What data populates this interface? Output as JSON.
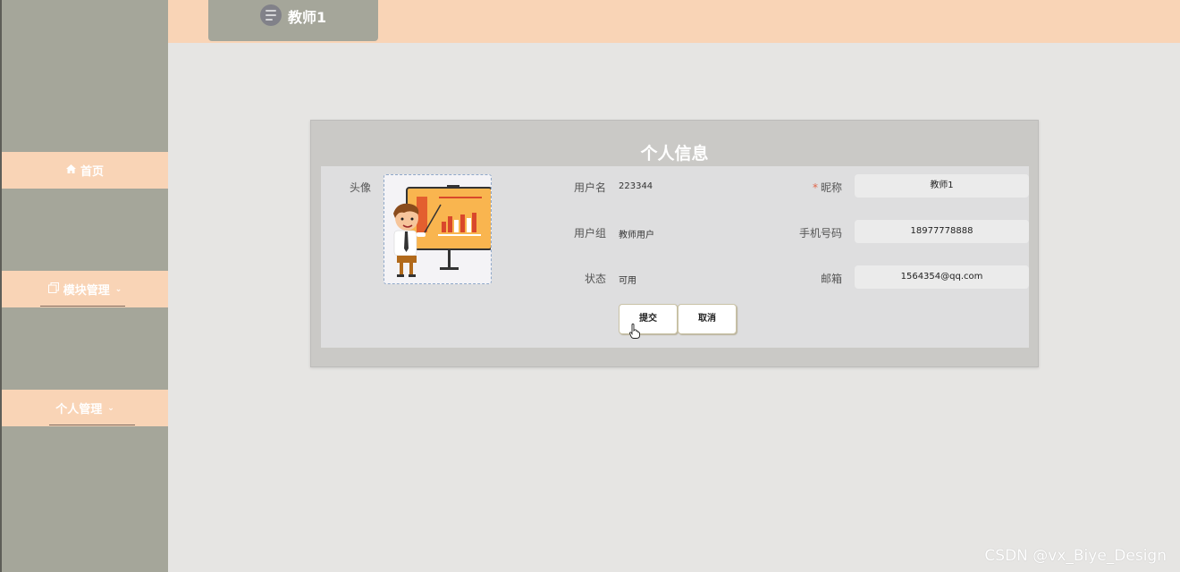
{
  "header": {
    "user_name": "教师1"
  },
  "sidebar": {
    "items": [
      {
        "label": "首页",
        "icon": "home-icon"
      },
      {
        "label": "模块管理",
        "icon": "copy-icon",
        "chevron": "⌄"
      },
      {
        "label": "个人管理",
        "chevron": "⌄"
      }
    ]
  },
  "form": {
    "title": "个人信息",
    "avatar_label": "头像",
    "username_label": "用户名",
    "username_value": "223344",
    "group_label": "用户组",
    "group_value": "教师用户",
    "status_label": "状态",
    "status_value": "可用",
    "nickname_label": "昵称",
    "nickname_required": "*",
    "nickname_value": "教师1",
    "phone_label": "手机号码",
    "phone_value": "18977778888",
    "email_label": "邮箱",
    "email_value": "1564354@qq.com",
    "submit_label": "提交",
    "cancel_label": "取消"
  },
  "watermark": "CSDN @vx_Biye_Design",
  "colors": {
    "accent_peach": "#f9d4b6",
    "sidebar_gray": "#a5a69a",
    "background": "#e6e5e3"
  }
}
